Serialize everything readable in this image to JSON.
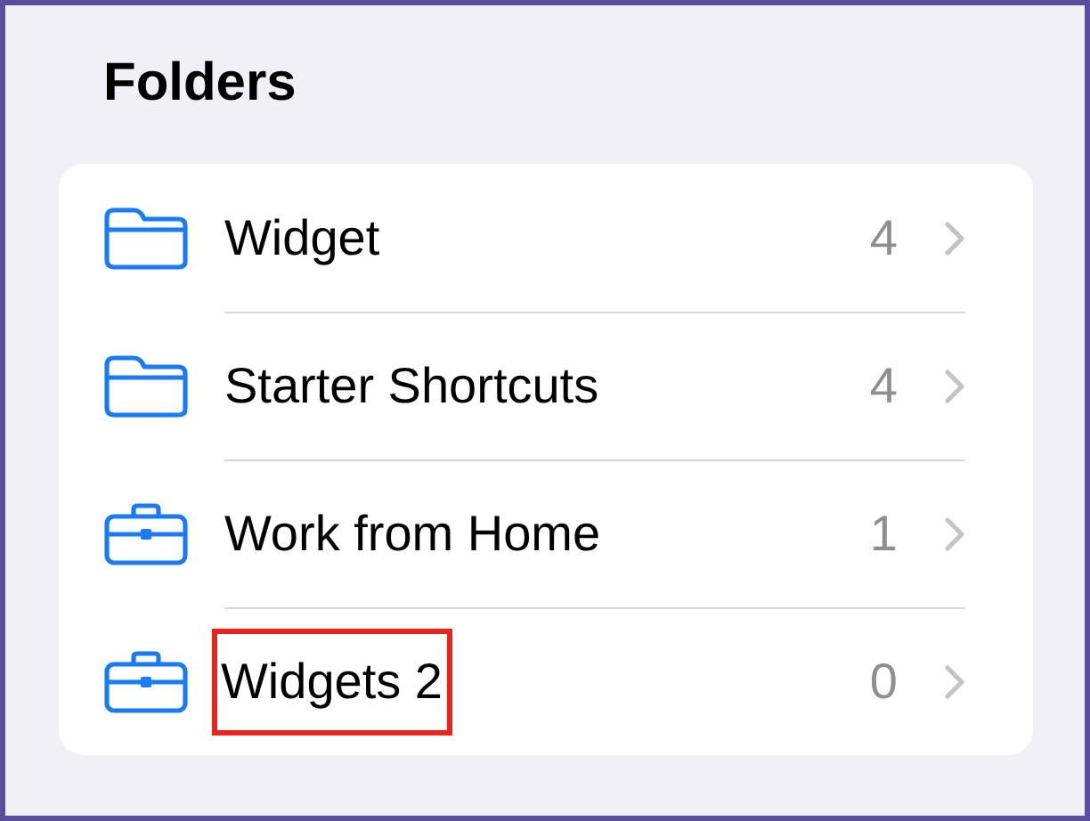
{
  "title": "Folders",
  "folders": [
    {
      "kind": "folder",
      "name": "Widget",
      "count": "4",
      "highlighted": false
    },
    {
      "kind": "folder",
      "name": "Starter Shortcuts",
      "count": "4",
      "highlighted": false
    },
    {
      "kind": "briefcase",
      "name": "Work from Home",
      "count": "1",
      "highlighted": false
    },
    {
      "kind": "briefcase",
      "name": "Widgets 2",
      "count": "0",
      "highlighted": true
    }
  ]
}
